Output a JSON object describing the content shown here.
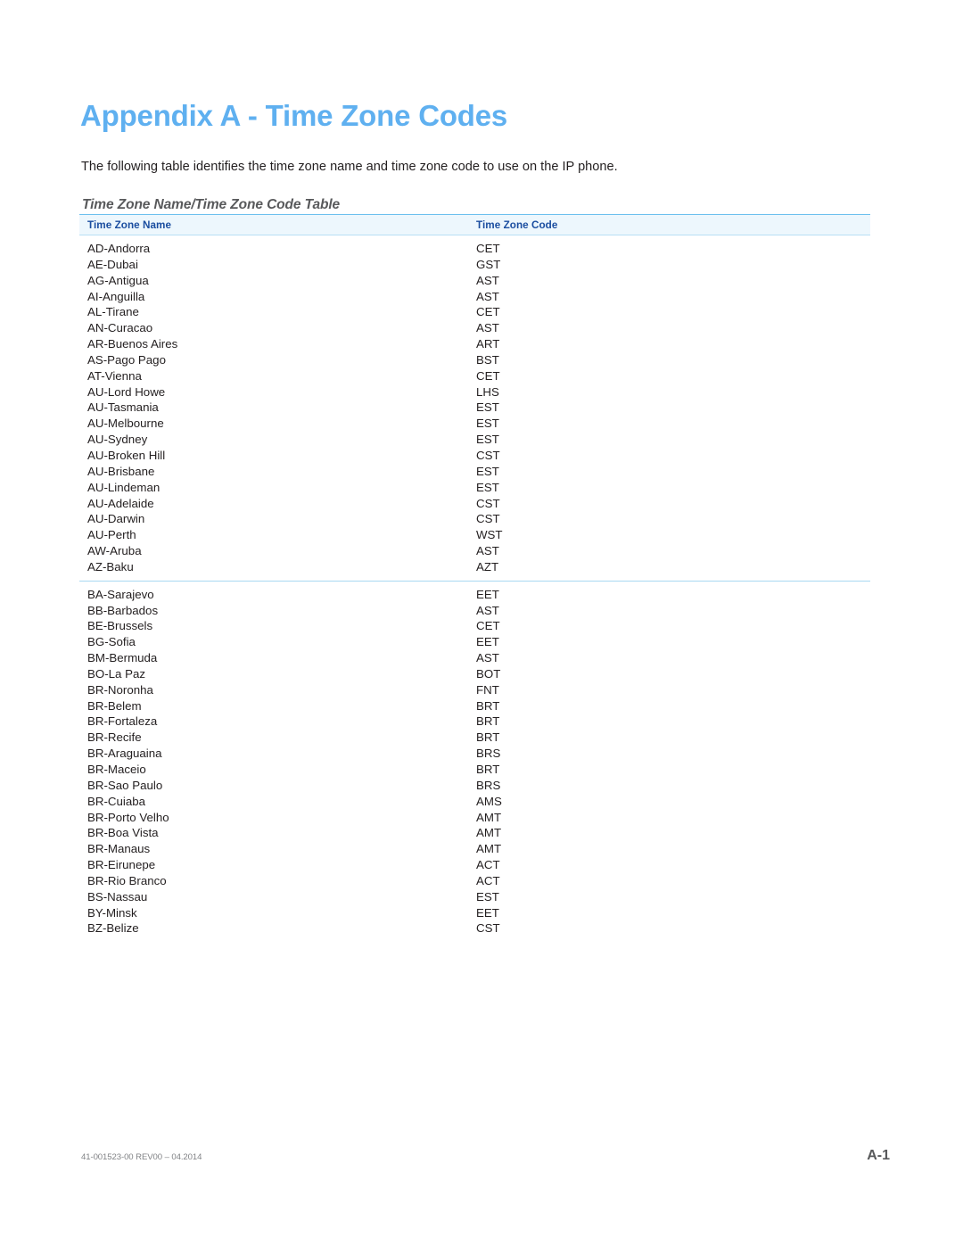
{
  "document": {
    "title": "Appendix A - Time Zone Codes",
    "intro": "The following table identifies the time zone name and time zone code to use on the IP phone.",
    "subtitle": "Time Zone Name/Time Zone Code Table"
  },
  "colors": {
    "title_blue": "#5fb0f0",
    "header_text_navy": "#1b4ea0",
    "header_fill": "#edf7fd",
    "rule_blue": "#6cc0ee",
    "divider_blue": "#a8d8f2",
    "body_text": "#231f20",
    "subtitle_gray": "#58595b",
    "footer_gray": "#808285"
  },
  "table": {
    "columns": [
      "Time Zone Name",
      "Time Zone Code"
    ],
    "groups": [
      {
        "rows": [
          {
            "name": "AD-Andorra",
            "code": "CET"
          },
          {
            "name": "AE-Dubai",
            "code": "GST"
          },
          {
            "name": "AG-Antigua",
            "code": "AST"
          },
          {
            "name": "AI-Anguilla",
            "code": "AST"
          },
          {
            "name": "AL-Tirane",
            "code": "CET"
          },
          {
            "name": "AN-Curacao",
            "code": "AST"
          },
          {
            "name": "AR-Buenos Aires",
            "code": "ART"
          },
          {
            "name": "AS-Pago Pago",
            "code": "BST"
          },
          {
            "name": "AT-Vienna",
            "code": "CET"
          },
          {
            "name": "AU-Lord Howe",
            "code": "LHS"
          },
          {
            "name": "AU-Tasmania",
            "code": "EST"
          },
          {
            "name": "AU-Melbourne",
            "code": "EST"
          },
          {
            "name": "AU-Sydney",
            "code": "EST"
          },
          {
            "name": "AU-Broken Hill",
            "code": "CST"
          },
          {
            "name": "AU-Brisbane",
            "code": "EST"
          },
          {
            "name": "AU-Lindeman",
            "code": "EST"
          },
          {
            "name": "AU-Adelaide",
            "code": "CST"
          },
          {
            "name": "AU-Darwin",
            "code": "CST"
          },
          {
            "name": "AU-Perth",
            "code": "WST"
          },
          {
            "name": "AW-Aruba",
            "code": "AST"
          },
          {
            "name": "AZ-Baku",
            "code": "AZT"
          }
        ]
      },
      {
        "divided": true,
        "rows": [
          {
            "name": "BA-Sarajevo",
            "code": "EET"
          },
          {
            "name": "BB-Barbados",
            "code": "AST"
          },
          {
            "name": "BE-Brussels",
            "code": "CET"
          },
          {
            "name": "BG-Sofia",
            "code": "EET"
          },
          {
            "name": "BM-Bermuda",
            "code": "AST"
          },
          {
            "name": "BO-La Paz",
            "code": "BOT"
          },
          {
            "name": "BR-Noronha",
            "code": "FNT"
          },
          {
            "name": "BR-Belem",
            "code": "BRT"
          },
          {
            "name": "BR-Fortaleza",
            "code": "BRT"
          },
          {
            "name": "BR-Recife",
            "code": "BRT"
          },
          {
            "name": "BR-Araguaina",
            "code": "BRS"
          },
          {
            "name": "BR-Maceio",
            "code": "BRT"
          },
          {
            "name": "BR-Sao Paulo",
            "code": "BRS"
          },
          {
            "name": "BR-Cuiaba",
            "code": "AMS"
          },
          {
            "name": "BR-Porto Velho",
            "code": "AMT"
          },
          {
            "name": "BR-Boa Vista",
            "code": "AMT"
          },
          {
            "name": "BR-Manaus",
            "code": "AMT"
          },
          {
            "name": "BR-Eirunepe",
            "code": "ACT"
          },
          {
            "name": "BR-Rio Branco",
            "code": "ACT"
          },
          {
            "name": "BS-Nassau",
            "code": "EST"
          },
          {
            "name": "BY-Minsk",
            "code": "EET"
          },
          {
            "name": "BZ-Belize",
            "code": "CST"
          }
        ]
      }
    ]
  },
  "footer": {
    "document_id": "41-001523-00 REV00 – 04.2014",
    "page_number": "A-1"
  }
}
